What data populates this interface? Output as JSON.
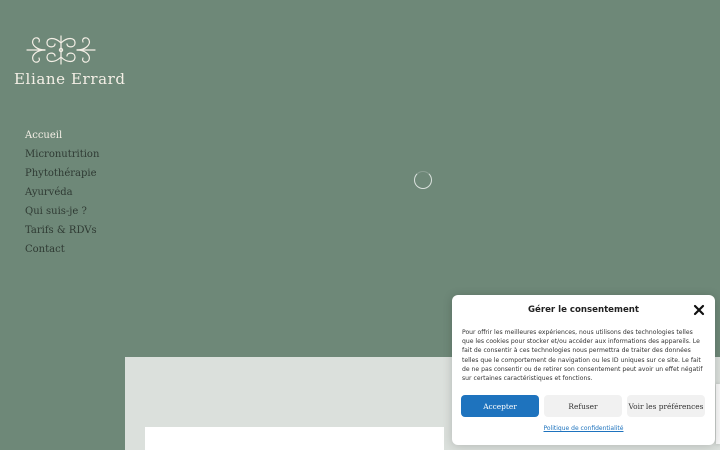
{
  "brand": {
    "name": "Eliane Errard",
    "logo_icon": "ornament-logo-icon",
    "text_color": "#f4efe6"
  },
  "nav": {
    "items": [
      {
        "label": "Accueil",
        "active": true
      },
      {
        "label": "Micronutrition",
        "active": false
      },
      {
        "label": "Phytothérapie",
        "active": false
      },
      {
        "label": "Ayurvéda",
        "active": false
      },
      {
        "label": "Qui suis-je ?",
        "active": false
      },
      {
        "label": "Tarifs & RDVs",
        "active": false
      },
      {
        "label": "Contact",
        "active": false
      }
    ]
  },
  "page": {
    "background": "#6e8878",
    "loading_icon": "spinner-icon"
  },
  "consent": {
    "title": "Gérer le consentement",
    "close_icon": "close-icon",
    "body": "Pour offrir les meilleures expériences, nous utilisons des technologies telles que les cookies pour stocker et/ou accéder aux informations des appareils. Le fait de consentir à ces technologies nous permettra de traiter des données telles que le comportement de navigation ou les ID uniques sur ce site. Le fait de ne pas consentir ou de retirer son consentement peut avoir un effet négatif sur certaines caractéristiques et fonctions.",
    "accept_label": "Accepter",
    "refuse_label": "Refuser",
    "prefs_label": "Voir les préférences",
    "policy_label": "Politique de confidentialité",
    "accent_color": "#1e73be"
  }
}
